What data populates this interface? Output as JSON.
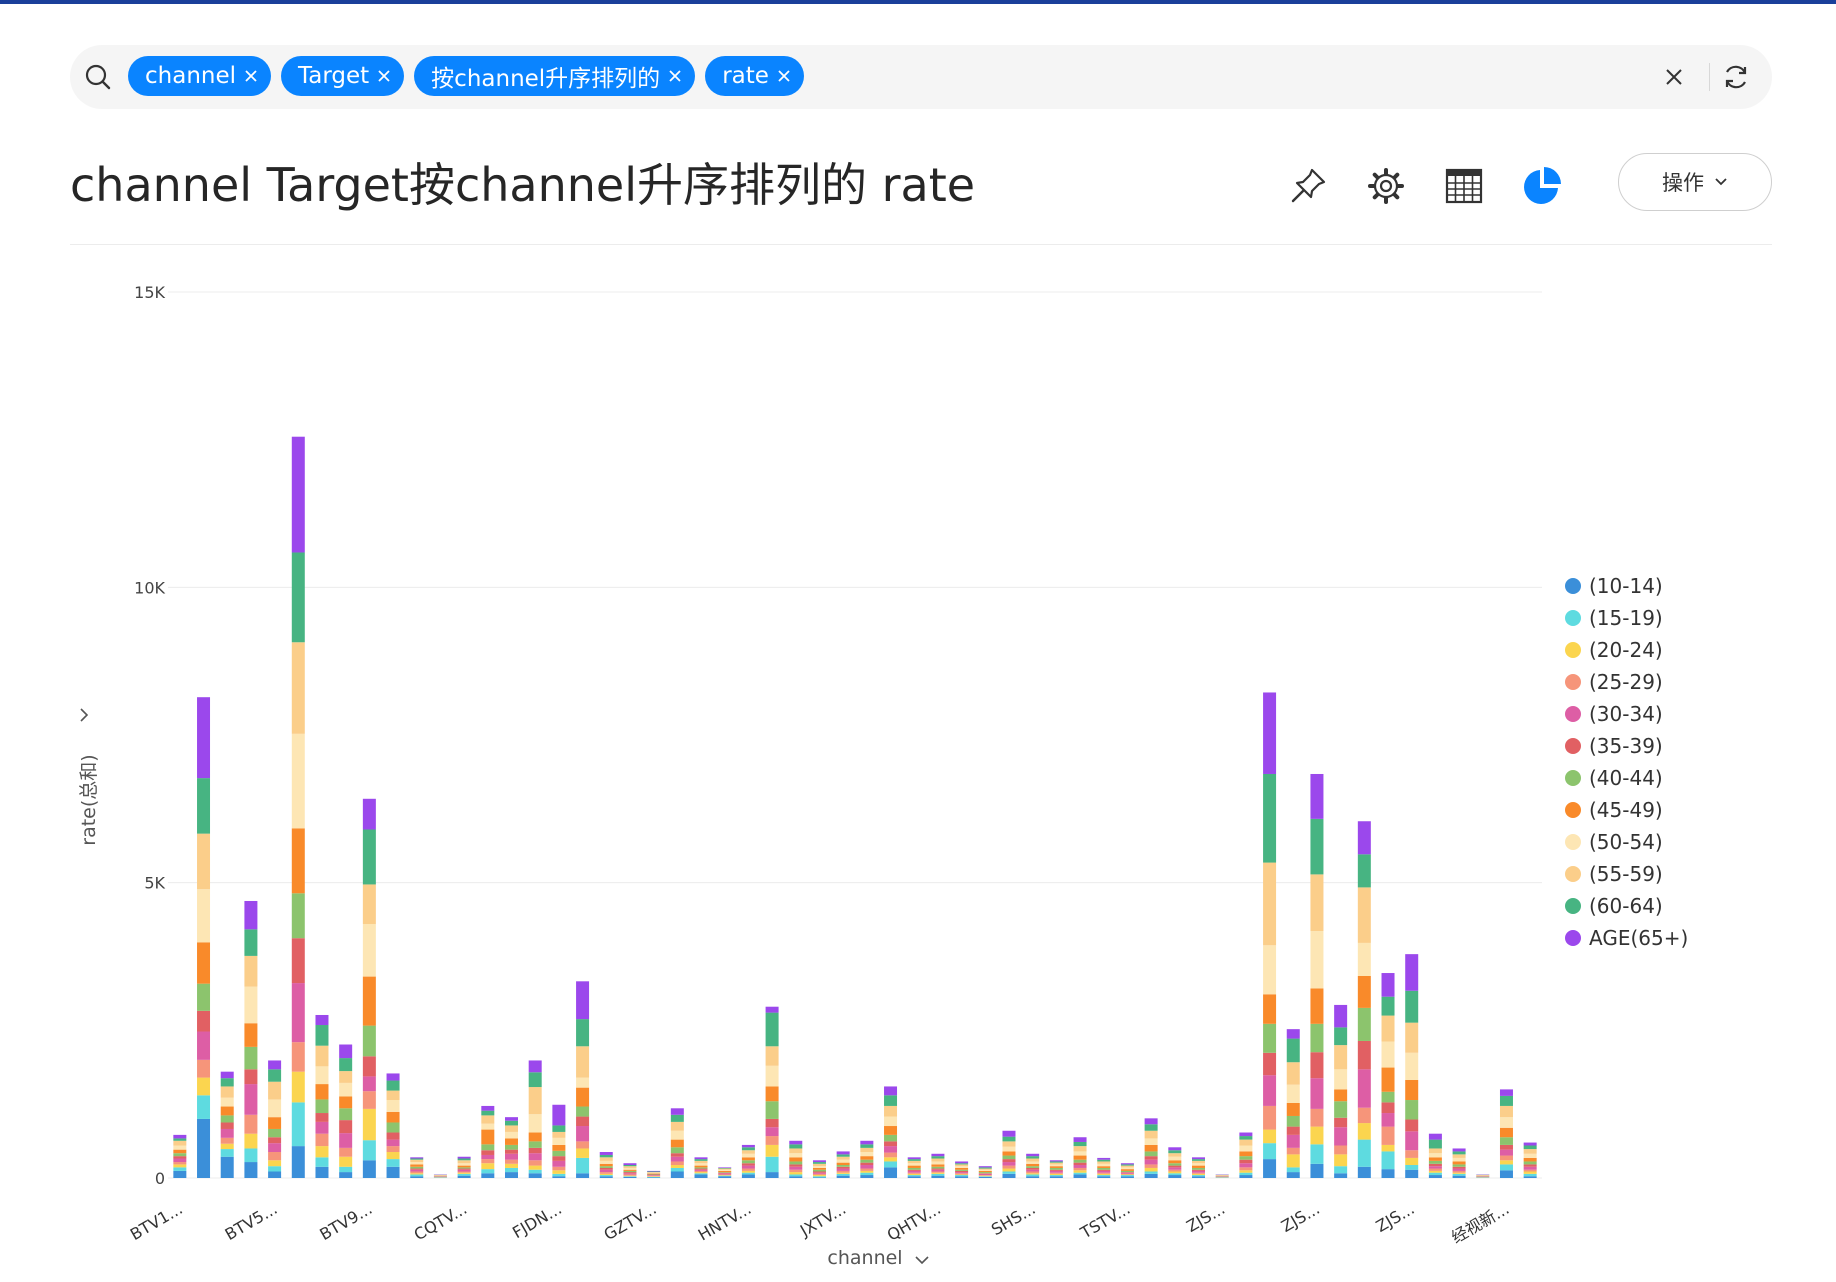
{
  "search": {
    "chips": [
      {
        "label": "channel"
      },
      {
        "label": "Target"
      },
      {
        "label": "按channel升序排列的"
      },
      {
        "label": "rate"
      }
    ]
  },
  "header": {
    "title": "channel Target按channel升序排列的 rate",
    "action_label": "操作"
  },
  "icons": {
    "search": "search-icon",
    "clear": "close-icon",
    "refresh": "refresh-icon",
    "pin": "pin-icon",
    "settings": "gear-icon",
    "table": "table-icon",
    "chart": "pie-chart-icon"
  },
  "colors": {
    "accent": "#0a84ff",
    "series": [
      "#3b8fd9",
      "#5edbe0",
      "#fbd54f",
      "#f6957a",
      "#dd5ea5",
      "#e16063",
      "#8cc46d",
      "#f98a2a",
      "#fde6b4",
      "#fbce8a",
      "#47b482",
      "#9b48ec"
    ]
  },
  "chart_data": {
    "type": "bar",
    "stacked": true,
    "xlabel": "channel",
    "ylabel": "rate(总和)",
    "ylim": [
      0,
      15000
    ],
    "yticks": [
      0,
      5000,
      10000,
      15000
    ],
    "ytick_labels": [
      "0",
      "5K",
      "10K",
      "15K"
    ],
    "grid": true,
    "legend_position": "right",
    "categories": [
      "BTV1...",
      "",
      "",
      "",
      "BTV5...",
      "",
      "",
      "",
      "BTV9...",
      "",
      "",
      "",
      "CQTV...",
      "",
      "",
      "",
      "FJDN...",
      "",
      "",
      "",
      "GZTV...",
      "",
      "",
      "",
      "HNTV...",
      "",
      "",
      "",
      "JXTV...",
      "",
      "",
      "",
      "QHTV...",
      "",
      "",
      "",
      "SHS...",
      "",
      "",
      "",
      "TSTV...",
      "",
      "",
      "",
      "ZJS...",
      "",
      "",
      "",
      "ZJS...",
      "",
      "",
      "",
      "ZJS...",
      "",
      "",
      "",
      "经视新...",
      ""
    ],
    "series": [
      {
        "name": "(10-14)",
        "values": [
          120,
          1000,
          360,
          270,
          110,
          540,
          190,
          100,
          300,
          190,
          30,
          5,
          40,
          80,
          100,
          80,
          30,
          80,
          30,
          20,
          10,
          110,
          60,
          30,
          60,
          100,
          30,
          10,
          40,
          50,
          180,
          30,
          40,
          30,
          20,
          70,
          30,
          30,
          60,
          30,
          30,
          70,
          50,
          30,
          5,
          50,
          320,
          100,
          240,
          80,
          190,
          150,
          140,
          50,
          40,
          5,
          130,
          30
        ]
      },
      {
        "name": "(15-19)",
        "values": [
          60,
          400,
          130,
          230,
          90,
          740,
          160,
          90,
          340,
          130,
          30,
          5,
          30,
          70,
          70,
          60,
          40,
          260,
          20,
          10,
          10,
          60,
          20,
          10,
          30,
          260,
          30,
          20,
          30,
          40,
          100,
          20,
          30,
          20,
          10,
          40,
          30,
          20,
          30,
          20,
          20,
          40,
          30,
          20,
          5,
          40,
          270,
          80,
          330,
          120,
          460,
          300,
          80,
          40,
          30,
          5,
          100,
          40
        ]
      },
      {
        "name": "(20-24)",
        "values": [
          50,
          300,
          90,
          250,
          100,
          520,
          190,
          170,
          530,
          120,
          20,
          5,
          20,
          100,
          70,
          70,
          60,
          160,
          20,
          10,
          10,
          50,
          20,
          10,
          30,
          200,
          40,
          20,
          20,
          30,
          70,
          20,
          20,
          10,
          10,
          50,
          20,
          20,
          40,
          20,
          10,
          60,
          30,
          20,
          5,
          40,
          230,
          220,
          300,
          200,
          280,
          110,
          120,
          30,
          20,
          5,
          70,
          40
        ]
      },
      {
        "name": "(25-29)",
        "values": [
          40,
          300,
          100,
          320,
          140,
          500,
          210,
          150,
          300,
          100,
          30,
          5,
          20,
          70,
          70,
          90,
          60,
          120,
          30,
          20,
          10,
          60,
          20,
          10,
          40,
          150,
          40,
          20,
          30,
          40,
          80,
          20,
          20,
          20,
          10,
          50,
          30,
          20,
          40,
          20,
          10,
          60,
          30,
          20,
          5,
          50,
          400,
          110,
          300,
          150,
          260,
          310,
          130,
          40,
          30,
          5,
          80,
          30
        ]
      },
      {
        "name": "(30-34)",
        "values": [
          60,
          480,
          150,
          520,
          150,
          1000,
          200,
          250,
          250,
          110,
          30,
          5,
          30,
          70,
          100,
          120,
          100,
          260,
          40,
          20,
          10,
          80,
          20,
          20,
          50,
          150,
          50,
          20,
          40,
          60,
          110,
          30,
          30,
          20,
          20,
          60,
          30,
          30,
          50,
          30,
          20,
          80,
          40,
          30,
          5,
          70,
          520,
          220,
          520,
          310,
          650,
          230,
          320,
          40,
          40,
          5,
          100,
          50
        ]
      },
      {
        "name": "(35-39)",
        "values": [
          40,
          350,
          110,
          250,
          100,
          760,
          150,
          220,
          340,
          120,
          20,
          5,
          20,
          80,
          70,
          90,
          80,
          160,
          30,
          20,
          10,
          60,
          20,
          10,
          40,
          140,
          40,
          20,
          30,
          40,
          80,
          20,
          20,
          20,
          10,
          50,
          30,
          20,
          40,
          20,
          10,
          60,
          30,
          20,
          5,
          60,
          380,
          140,
          440,
          160,
          480,
          180,
          200,
          40,
          30,
          5,
          80,
          40
        ]
      },
      {
        "name": "(40-44)",
        "values": [
          50,
          460,
          120,
          380,
          140,
          760,
          230,
          200,
          520,
          170,
          30,
          5,
          20,
          100,
          80,
          110,
          90,
          170,
          30,
          20,
          10,
          100,
          20,
          10,
          50,
          300,
          50,
          30,
          30,
          50,
          110,
          30,
          30,
          20,
          20,
          60,
          30,
          30,
          50,
          30,
          20,
          80,
          40,
          30,
          5,
          60,
          490,
          180,
          480,
          280,
          560,
          180,
          330,
          50,
          40,
          5,
          130,
          50
        ]
      },
      {
        "name": "(45-49)",
        "values": [
          60,
          700,
          150,
          400,
          200,
          1100,
          260,
          200,
          830,
          180,
          40,
          5,
          30,
          250,
          110,
          150,
          100,
          320,
          40,
          20,
          10,
          130,
          30,
          20,
          50,
          250,
          70,
          30,
          40,
          60,
          150,
          40,
          40,
          30,
          20,
          70,
          40,
          30,
          70,
          30,
          30,
          110,
          50,
          40,
          5,
          80,
          500,
          220,
          600,
          200,
          540,
          410,
          340,
          60,
          50,
          5,
          160,
          60
        ]
      },
      {
        "name": "(50-54)",
        "values": [
          70,
          900,
          150,
          620,
          300,
          1600,
          300,
          230,
          890,
          200,
          40,
          5,
          40,
          100,
          110,
          310,
          120,
          170,
          50,
          30,
          10,
          150,
          40,
          20,
          60,
          350,
          70,
          30,
          50,
          70,
          160,
          40,
          50,
          30,
          20,
          80,
          40,
          30,
          70,
          40,
          30,
          110,
          60,
          40,
          5,
          100,
          830,
          310,
          970,
          340,
          560,
          440,
          460,
          70,
          60,
          5,
          180,
          70
        ]
      },
      {
        "name": "(55-59)",
        "values": [
          80,
          940,
          190,
          520,
          300,
          1550,
          350,
          200,
          670,
          160,
          40,
          5,
          50,
          140,
          110,
          460,
          100,
          530,
          60,
          30,
          10,
          150,
          40,
          20,
          60,
          330,
          80,
          40,
          50,
          70,
          180,
          40,
          50,
          30,
          20,
          90,
          50,
          30,
          90,
          40,
          30,
          130,
          60,
          40,
          5,
          100,
          1400,
          380,
          960,
          410,
          940,
          440,
          510,
          80,
          60,
          5,
          190,
          80
        ]
      },
      {
        "name": "(60-64)",
        "values": [
          40,
          940,
          140,
          450,
          210,
          1520,
          350,
          220,
          930,
          170,
          20,
          5,
          30,
          80,
          80,
          250,
          110,
          460,
          40,
          20,
          10,
          120,
          30,
          10,
          50,
          570,
          70,
          30,
          40,
          60,
          180,
          30,
          40,
          20,
          20,
          80,
          40,
          20,
          70,
          30,
          20,
          110,
          50,
          30,
          5,
          60,
          1500,
          400,
          940,
          300,
          560,
          320,
          540,
          150,
          50,
          5,
          170,
          60
        ]
      },
      {
        "name": "AGE(65+)",
        "values": [
          60,
          1370,
          110,
          480,
          150,
          1960,
          170,
          230,
          520,
          120,
          20,
          5,
          30,
          80,
          60,
          200,
          350,
          640,
          50,
          30,
          10,
          110,
          30,
          10,
          40,
          100,
          60,
          30,
          50,
          60,
          150,
          30,
          40,
          30,
          20,
          100,
          40,
          20,
          80,
          30,
          20,
          100,
          50,
          30,
          5,
          60,
          1380,
          160,
          760,
          380,
          560,
          400,
          620,
          100,
          50,
          5,
          110,
          50
        ]
      }
    ]
  }
}
